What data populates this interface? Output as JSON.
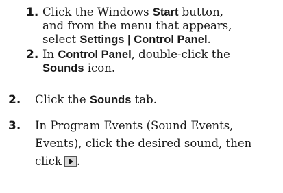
{
  "substeps": [
    {
      "num": "1.",
      "line1_pre": "Click the Windows ",
      "line1_bold": "Start",
      "line1_post": " button,",
      "line2": "and from the menu that appears,",
      "line3_pre": "select ",
      "line3_bold": "Settings | Control Panel",
      "line3_post": "."
    },
    {
      "num": "2.",
      "line1_pre": "In ",
      "line1_bold": "Control Panel",
      "line1_post": ", double-click the",
      "line2_bold": "Sounds",
      "line2_post": " icon."
    }
  ],
  "steps": [
    {
      "num": "2.",
      "pre": "Click the ",
      "bold": "Sounds",
      "post": " tab."
    },
    {
      "num": "3.",
      "line1": "In Program Events (Sound Events,",
      "line2": "Events), click the desired sound, then",
      "line3": "click"
    }
  ],
  "icons": {
    "play_button": "play-button-icon"
  }
}
